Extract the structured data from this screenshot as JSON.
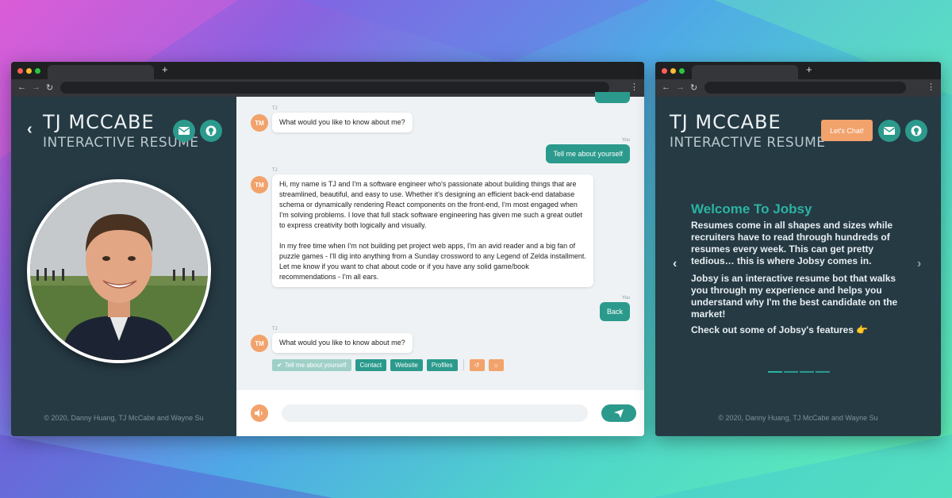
{
  "colors": {
    "teal": "#2b9a8c",
    "orange": "#f2a26b",
    "panel": "#263a44",
    "chat_bg": "#eef2f4"
  },
  "left": {
    "brand": {
      "name": "TJ MCCABE",
      "subtitle": "INTERACTIVE RESUME"
    },
    "footer": "© 2020, Danny Huang, TJ McCabe and Wayne Su",
    "chat": {
      "messages": [
        {
          "from": "TJ",
          "avatar": "TM",
          "text": "What would you like to know about me?"
        },
        {
          "from": "You",
          "text": "Tell me about yourself"
        },
        {
          "from": "TJ",
          "avatar": "TM",
          "paragraphs": [
            "Hi, my name is TJ and I'm a software engineer who's passionate about building things that are streamlined, beautiful, and easy to use. Whether it's designing an efficient back-end database schema or dynamically rendering React components on the front-end, I'm most engaged when I'm solving problems. I love that full stack software engineering has given me such a great outlet to express creativity both logically and visually.",
            "In my free time when I'm not building pet project web apps, I'm an avid reader and a big fan of puzzle games - I'll dig into anything from a Sunday crossword to any Legend of Zelda installment. Let me know if you want to chat about code or if you have any solid game/book recommendations - I'm all ears."
          ]
        },
        {
          "from": "You",
          "text": "Back"
        },
        {
          "from": "TJ",
          "avatar": "TM",
          "text": "What would you like to know about me?"
        }
      ],
      "quick_replies": [
        "Tell me about yourself",
        "Contact",
        "Website",
        "Profiles"
      ]
    }
  },
  "right": {
    "brand": {
      "name": "TJ MCCABE",
      "subtitle": "INTERACTIVE RESUME"
    },
    "lets_chat": "Let's Chat!",
    "carousel": {
      "title": "Welcome To Jobsy",
      "p1": "Resumes come in all shapes and sizes while recruiters have to read through hundreds of resumes every week. This can get pretty tedious… this is where Jobsy comes in.",
      "p2": "Jobsy is an interactive resume bot that walks you through my experience and helps you understand why I'm the best candidate on the market!",
      "p3": "Check out some of Jobsy's features 👉",
      "active_slide": 1,
      "slide_count": 4
    },
    "footer": "© 2020, Danny Huang, TJ McCabe and Wayne Su"
  },
  "icons": [
    "envelope-icon",
    "github-icon",
    "chevron-left-icon",
    "chevron-right-icon",
    "check-icon",
    "undo-icon",
    "home-icon",
    "speaker-icon",
    "send-icon"
  ]
}
